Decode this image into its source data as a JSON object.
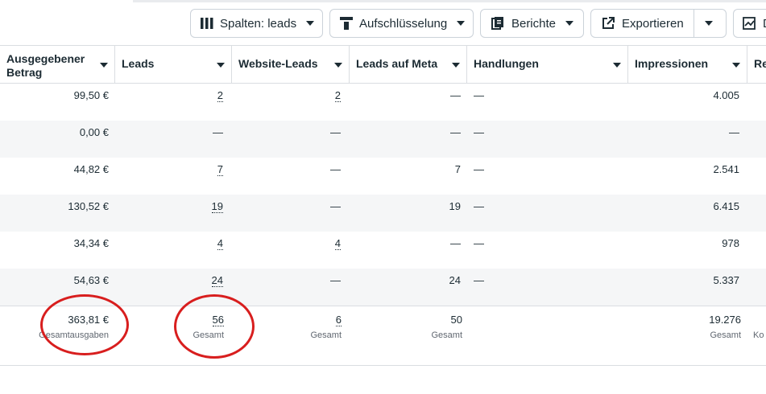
{
  "toolbar": {
    "columns_label": "Spalten: leads",
    "breakdown_label": "Aufschlüsselung",
    "reports_label": "Berichte",
    "export_label": "Exportieren",
    "cut_label": "D"
  },
  "columns": [
    {
      "label_line1": "Ausgegebener",
      "label_line2": "Betrag"
    },
    {
      "label_line1": "Leads"
    },
    {
      "label_line1": "Website-Leads"
    },
    {
      "label_line1": "Leads auf Meta"
    },
    {
      "label_line1": "Handlungen"
    },
    {
      "label_line1": "Impressionen"
    },
    {
      "label_line1": "Re"
    }
  ],
  "rows": [
    {
      "spend": "99,50 €",
      "leads": "2",
      "web": "2",
      "meta": "—",
      "actions": "—",
      "impr": "4.005"
    },
    {
      "spend": "0,00 €",
      "leads": "—",
      "web": "—",
      "meta": "—",
      "actions": "—",
      "impr": "—"
    },
    {
      "spend": "44,82 €",
      "leads": "7",
      "web": "—",
      "meta": "7",
      "actions": "—",
      "impr": "2.541"
    },
    {
      "spend": "130,52 €",
      "leads": "19",
      "web": "—",
      "meta": "19",
      "actions": "—",
      "impr": "6.415"
    },
    {
      "spend": "34,34 €",
      "leads": "4",
      "web": "4",
      "meta": "—",
      "actions": "—",
      "impr": "978"
    },
    {
      "spend": "54,63 €",
      "leads": "24",
      "web": "—",
      "meta": "24",
      "actions": "—",
      "impr": "5.337"
    }
  ],
  "totals": {
    "spend": "363,81 €",
    "spend_sub": "Gesamtausgaben",
    "leads": "56",
    "leads_sub": "Gesamt",
    "web": "6",
    "web_sub": "Gesamt",
    "meta": "50",
    "meta_sub": "Gesamt",
    "impr": "19.276",
    "impr_sub": "Gesamt",
    "cut_sub": "Ko"
  },
  "colors": {
    "annotation": "#d81e1e",
    "alt_row": "#f5f6f7",
    "border": "#dadde1"
  }
}
